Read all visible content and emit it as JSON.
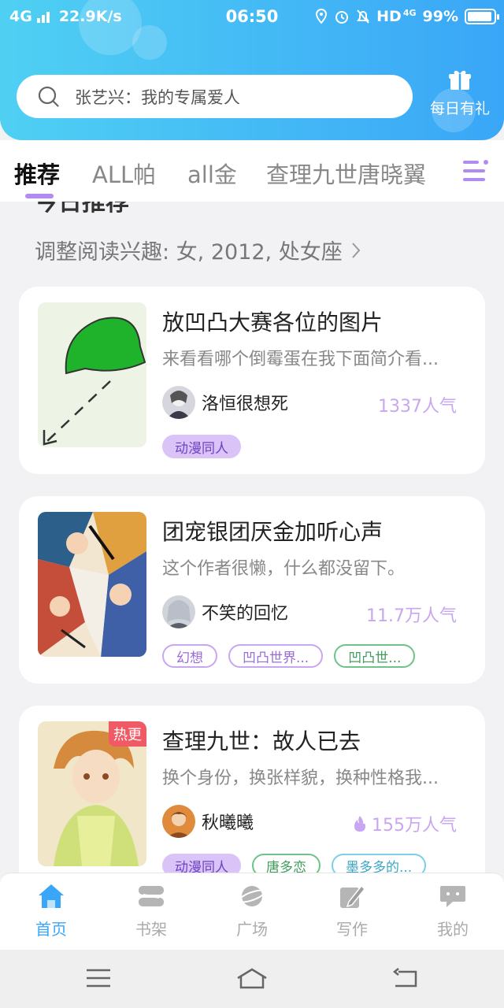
{
  "status_bar": {
    "network": "4G",
    "speed": "22.9K/s",
    "time": "06:50",
    "hd": "HD",
    "net_small": "4G",
    "battery": "99%"
  },
  "search": {
    "placeholder": "张艺兴：我的专属爱人",
    "icon": "search-icon"
  },
  "gift": {
    "label": "每日有礼",
    "icon": "gift-icon"
  },
  "tabs": [
    {
      "label": "推荐",
      "active": true
    },
    {
      "label": "ALL帕"
    },
    {
      "label": "all金"
    },
    {
      "label": "查理九世唐晓翼"
    }
  ],
  "section": {
    "title": "今日推荐",
    "interest": "调整阅读兴趣: 女, 2012, 处女座"
  },
  "cards": [
    {
      "title": "放凹凸大赛各位的图片",
      "desc": "来看看哪个倒霉蛋在我下面简介看...",
      "author": "洛恒很想死",
      "popularity": "1337人气",
      "tags": [
        "动漫同人"
      ]
    },
    {
      "title": "团宠银团厌金加听心声",
      "desc": "这个作者很懒，什么都没留下。",
      "author": "不笑的回忆",
      "popularity": "11.7万人气",
      "tags": [
        "幻想",
        "凹凸世界...",
        "凹凸世..."
      ]
    },
    {
      "title": "查理九世：故人已去",
      "desc": "换个身份，换张样貌，换种性格我...",
      "author": "秋曦曦",
      "popularity": "155万人气",
      "badge": "热更",
      "tags": [
        "动漫同人",
        "唐多恋",
        "墨多多的..."
      ]
    }
  ],
  "bottom_nav": [
    {
      "label": "首页",
      "icon": "home-icon",
      "active": true
    },
    {
      "label": "书架",
      "icon": "bookshelf-icon"
    },
    {
      "label": "广场",
      "icon": "planet-icon"
    },
    {
      "label": "写作",
      "icon": "pen-icon"
    },
    {
      "label": "我的",
      "icon": "chat-bubble-icon"
    }
  ],
  "colors": {
    "header_start": "#4fd0f3",
    "header_end": "#3aa6f7",
    "accent_purple": "#b18cf0",
    "nav_active": "#3aa6f7"
  }
}
